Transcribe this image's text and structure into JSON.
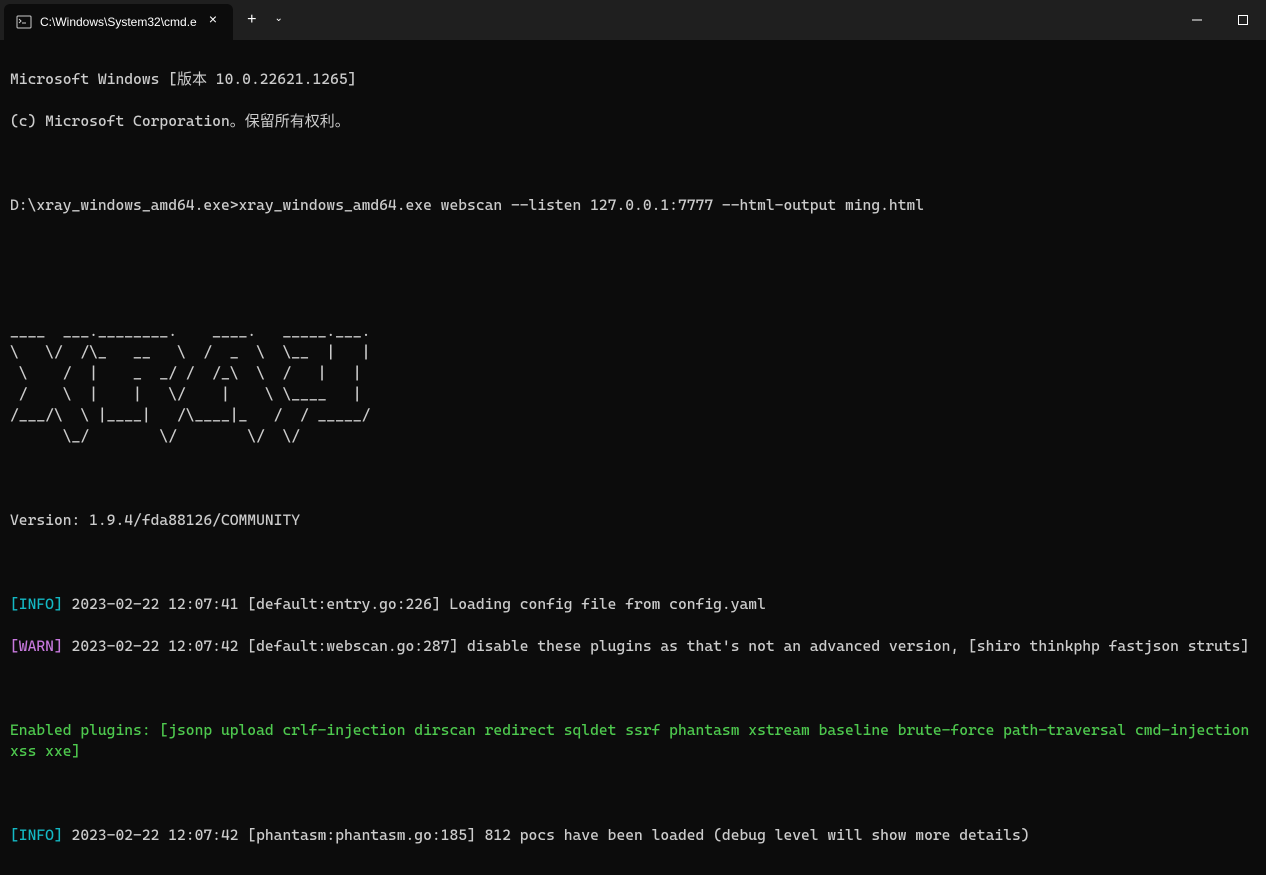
{
  "titlebar": {
    "tab_title": "C:\\Windows\\System32\\cmd.e",
    "close_glyph": "×",
    "new_tab_glyph": "+",
    "dropdown_glyph": "⌄"
  },
  "terminal": {
    "line1": "Microsoft Windows [版本 10.0.22621.1265]",
    "line2": "(c) Microsoft Corporation。保留所有权利。",
    "prompt": "D:\\xray_windows_amd64.exe>",
    "command": "xray_windows_amd64.exe webscan --listen 127.0.0.1:7777 --html-output ming.html",
    "ascii_art": "____  ___.________.    ____.   _____.___.\n\\   \\/  /\\_   __   \\  /  _  \\  \\__  |   |\n \\    /  |    _  _/ /  /_\\  \\  /   |   |\n /    \\  |    |   \\/    |    \\ \\____   |\n/___/\\  \\ |____|   /\\____|_   /  / _____/\n      \\_/        \\/        \\/  \\/",
    "version": "Version: 1.9.4/fda88126/COMMUNITY",
    "log1": {
      "level": "[INFO]",
      "rest": " 2023-02-22 12:07:41 [default:entry.go:226] Loading config file from config.yaml"
    },
    "log2": {
      "level": "[WARN]",
      "rest": " 2023-02-22 12:07:42 [default:webscan.go:287] disable these plugins as that's not an advanced version, [shiro thinkphp fastjson struts]"
    },
    "enabled": "Enabled plugins: [jsonp upload crlf-injection dirscan redirect sqldet ssrf phantasm xstream baseline brute-force path-traversal cmd-injection xss xxe]",
    "log3": {
      "level": "[INFO]",
      "rest": " 2023-02-22 12:07:42 [phantasm:phantasm.go:185] 812 pocs have been loaded (debug level will show more details)"
    }
  }
}
